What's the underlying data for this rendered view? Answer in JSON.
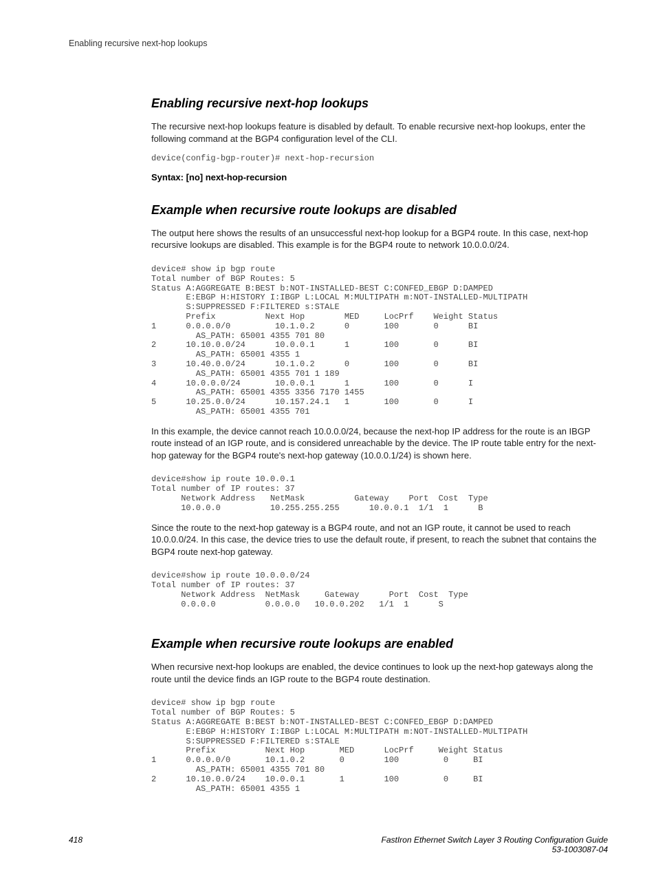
{
  "running_head": "Enabling recursive next-hop lookups",
  "section1": {
    "heading": "Enabling recursive next-hop lookups",
    "para1": "The recursive next-hop lookups feature is disabled by default. To enable recursive next-hop lookups, enter the following command at the BGP4 configuration level of the CLI.",
    "code1": "device(config-bgp-router)# next-hop-recursion",
    "syntax": "Syntax: [no] next-hop-recursion"
  },
  "section2": {
    "heading": "Example when recursive route lookups are disabled",
    "para1": "The output here shows the results of an unsuccessful next-hop lookup for a BGP4 route. In this case, next-hop recursive lookups are disabled. This example is for the BGP4 route to network 10.0.0.0/24.",
    "code1": "device# show ip bgp route\nTotal number of BGP Routes: 5\nStatus A:AGGREGATE B:BEST b:NOT-INSTALLED-BEST C:CONFED_EBGP D:DAMPED\n       E:EBGP H:HISTORY I:IBGP L:LOCAL M:MULTIPATH m:NOT-INSTALLED-MULTIPATH\n       S:SUPPRESSED F:FILTERED s:STALE\n       Prefix          Next Hop        MED     LocPrf    Weight Status\n1      0.0.0.0/0         10.1.0.2      0       100       0      BI\n         AS_PATH: 65001 4355 701 80\n2      10.10.0.0/24      10.0.0.1      1       100       0      BI\n         AS_PATH: 65001 4355 1\n3      10.40.0.0/24      10.1.0.2      0       100       0      BI\n         AS_PATH: 65001 4355 701 1 189\n4      10.0.0.0/24       10.0.0.1      1       100       0      I\n         AS_PATH: 65001 4355 3356 7170 1455\n5      10.25.0.0/24      10.157.24.1   1       100       0      I\n         AS_PATH: 65001 4355 701",
    "para2": "In this example, the device cannot reach 10.0.0.0/24, because the next-hop IP address for the route is an IBGP route instead of an IGP route, and is considered unreachable by the device. The IP route table entry for the next-hop gateway for the BGP4 route's next-hop gateway (10.0.0.1/24) is shown here.",
    "code2": "device#show ip route 10.0.0.1\nTotal number of IP routes: 37\n      Network Address   NetMask          Gateway    Port  Cost  Type\n      10.0.0.0          10.255.255.255      10.0.0.1  1/1  1      B",
    "para3": "Since the route to the next-hop gateway is a BGP4 route, and not an IGP route, it cannot be used to reach 10.0.0.0/24. In this case, the device tries to use the default route, if present, to reach the subnet that contains the BGP4 route next-hop gateway.",
    "code3": "device#show ip route 10.0.0.0/24\nTotal number of IP routes: 37\n      Network Address  NetMask     Gateway      Port  Cost  Type\n      0.0.0.0          0.0.0.0   10.0.0.202   1/1  1      S"
  },
  "section3": {
    "heading": "Example when recursive route lookups are enabled",
    "para1": "When recursive next-hop lookups are enabled, the device continues to look up the next-hop gateways along the route until the device finds an IGP route to the BGP4 route destination.",
    "code1": "device# show ip bgp route\nTotal number of BGP Routes: 5\nStatus A:AGGREGATE B:BEST b:NOT-INSTALLED-BEST C:CONFED_EBGP D:DAMPED\n       E:EBGP H:HISTORY I:IBGP L:LOCAL M:MULTIPATH m:NOT-INSTALLED-MULTIPATH\n       S:SUPPRESSED F:FILTERED s:STALE\n       Prefix          Next Hop       MED      LocPrf     Weight Status\n1      0.0.0.0/0       10.1.0.2       0        100         0     BI\n         AS_PATH: 65001 4355 701 80\n2      10.10.0.0/24    10.0.0.1       1        100         0     BI\n         AS_PATH: 65001 4355 1"
  },
  "footer": {
    "page_no": "418",
    "guide": "FastIron Ethernet Switch Layer 3 Routing Configuration Guide",
    "doc_no": "53-1003087-04"
  }
}
